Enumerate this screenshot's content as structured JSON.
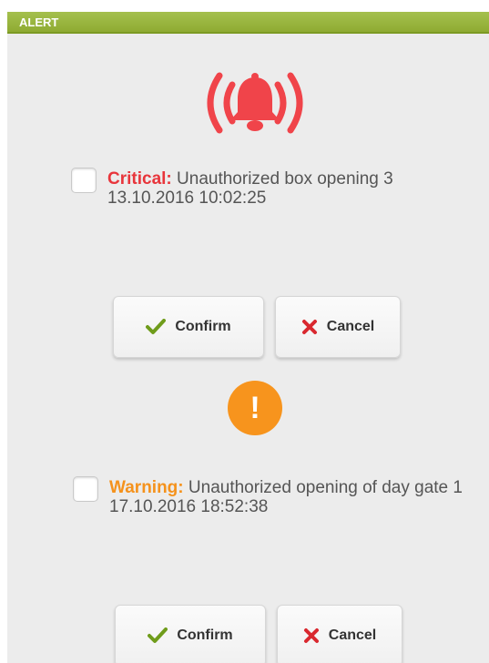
{
  "window": {
    "title": "ALERT"
  },
  "alerts": [
    {
      "severity": "Critical:",
      "message": "Unauthorized box opening 3 13.10.2016 10:02:25",
      "confirm_label": "Confirm",
      "cancel_label": "Cancel"
    },
    {
      "severity": "Warning:",
      "message": "Unauthorized opening of day gate 1 17.10.2016 18:52:38",
      "confirm_label": "Confirm",
      "cancel_label": "Cancel"
    }
  ],
  "warning_badge": {
    "glyph": "!"
  },
  "icons": {
    "bell": "alarm-bell-icon",
    "warning": "exclamation-icon",
    "confirm": "checkmark-icon",
    "cancel": "x-icon"
  },
  "colors": {
    "titlebar": "#9bb83f",
    "critical": "#e8353b",
    "warning": "#f5921c",
    "confirm_check": "#6f9c1b",
    "cancel_x": "#d9282f"
  }
}
